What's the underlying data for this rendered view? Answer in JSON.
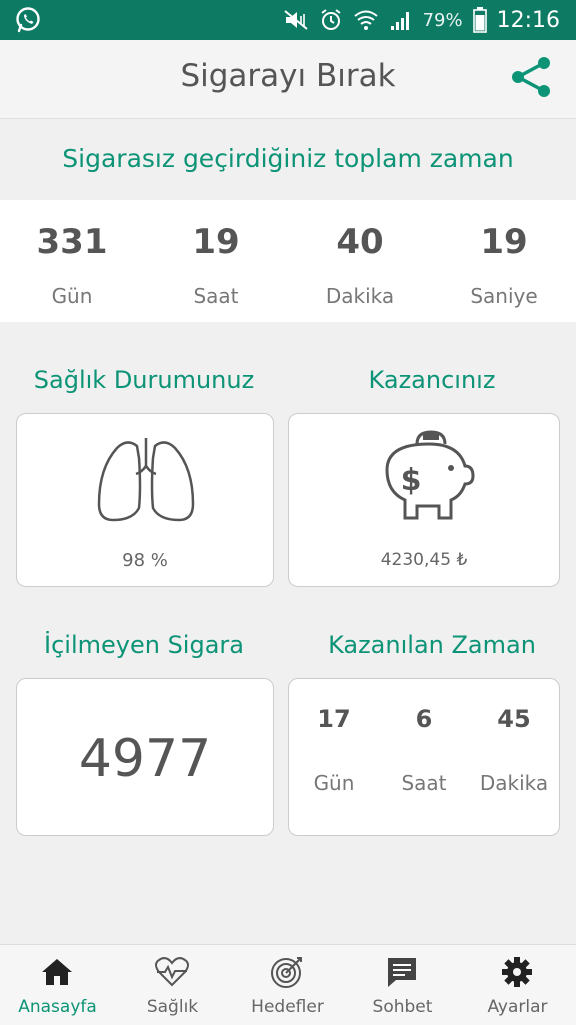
{
  "status_bar": {
    "battery_percent": "79%",
    "time": "12:16"
  },
  "app_bar": {
    "title": "Sigarayı Bırak"
  },
  "total_time": {
    "header": "Sigarasız geçirdiğiniz toplam zaman",
    "counters": [
      {
        "value": "331",
        "label": "Gün"
      },
      {
        "value": "19",
        "label": "Saat"
      },
      {
        "value": "40",
        "label": "Dakika"
      },
      {
        "value": "19",
        "label": "Saniye"
      }
    ]
  },
  "health": {
    "title": "Sağlık Durumunuz",
    "value": "98 %"
  },
  "savings": {
    "title": "Kazancınız",
    "value": "4230,45 ₺"
  },
  "cigarettes": {
    "title": "İçilmeyen Sigara",
    "value": "4977"
  },
  "time_gained": {
    "title": "Kazanılan Zaman",
    "items": [
      {
        "value": "17",
        "label": "Gün"
      },
      {
        "value": "6",
        "label": "Saat"
      },
      {
        "value": "45",
        "label": "Dakika"
      }
    ]
  },
  "nav": [
    {
      "label": "Anasayfa",
      "icon": "home-icon",
      "active": true
    },
    {
      "label": "Sağlık",
      "icon": "heart-pulse-icon",
      "active": false
    },
    {
      "label": "Hedefler",
      "icon": "target-icon",
      "active": false
    },
    {
      "label": "Sohbet",
      "icon": "chat-icon",
      "active": false
    },
    {
      "label": "Ayarlar",
      "icon": "gear-icon",
      "active": false
    }
  ],
  "colors": {
    "accent": "#0d9477",
    "status_bar": "#0d7a64"
  }
}
